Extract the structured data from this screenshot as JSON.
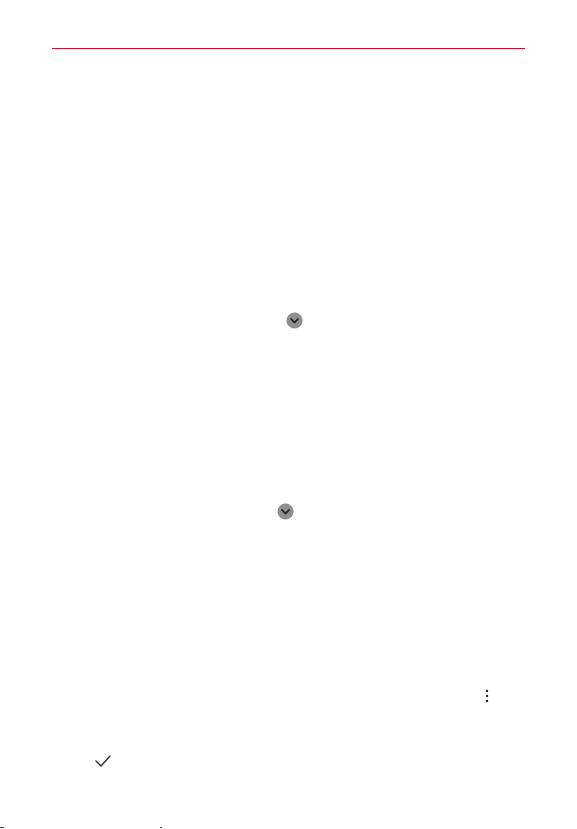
{
  "page": {
    "rule_color": "#c8102e",
    "icons": [
      {
        "name": "chevron-down-circle-icon",
        "color": "#7a7a7a"
      },
      {
        "name": "chevron-down-circle-icon",
        "color": "#7a7a7a"
      },
      {
        "name": "more-vert-icon",
        "color": "#222222"
      },
      {
        "name": "check-icon",
        "color": "#333333"
      }
    ]
  }
}
